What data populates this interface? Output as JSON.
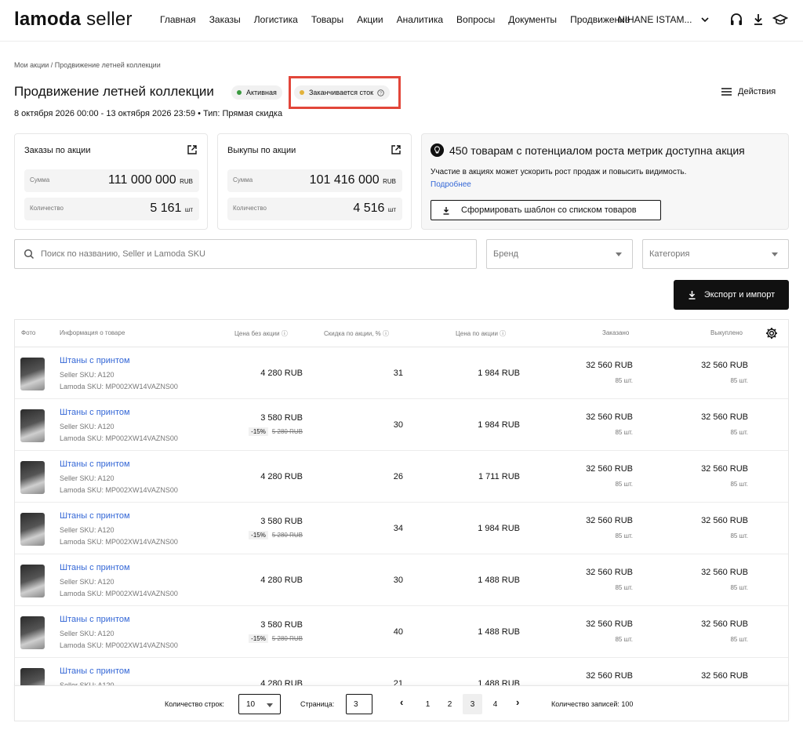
{
  "header": {
    "logo_brand": "lamoda",
    "logo_suffix": "seller",
    "nav": [
      "Главная",
      "Заказы",
      "Логистика",
      "Товары",
      "Акции",
      "Аналитика",
      "Вопросы",
      "Документы",
      "Продвижение"
    ],
    "user": "NIHANE ISTAM...",
    "icons": [
      "headphones-icon",
      "download-icon",
      "graduation-cap-icon"
    ]
  },
  "breadcrumb": "Мои акции  /  Продвижение летней коллекции",
  "promo_page": {
    "title": "Продвижение летней коллекции",
    "badge_active": "Активная",
    "badge_stock": "Заканчивается сток",
    "dates": "8 октября 2026 00:00 - 13 октября 2026 23:59  •  Тип: Прямая скидка",
    "actions": "Действия",
    "colors": {
      "active_dot": "#3a9a3f",
      "stock_dot": "#e2b23a",
      "highlight": "#e2463a",
      "link": "#3467d6"
    }
  },
  "cards": {
    "orders": {
      "title": "Заказы по акции",
      "sum_label": "Сумма",
      "sum_value": "111 000 000",
      "sum_unit": "RUB",
      "qty_label": "Количество",
      "qty_value": "5 161",
      "qty_unit": "шт"
    },
    "buyouts": {
      "title": "Выкупы по акции",
      "sum_label": "Сумма",
      "sum_value": "101 416 000",
      "sum_unit": "RUB",
      "qty_label": "Количество",
      "qty_value": "4 516",
      "qty_unit": "шт"
    }
  },
  "promo": {
    "title": "450 товарам с потенциалом роста метрик доступна акция",
    "text": "Участие в акциях может ускорить рост продаж и повысить видимость.",
    "link": "Подробнее",
    "button": "Сформировать шаблон со списком товаров"
  },
  "filters": {
    "search_placeholder": "Поиск по названию, Seller и Lamoda SKU",
    "brand": "Бренд",
    "category": "Категория",
    "export": "Экспорт и импорт"
  },
  "table": {
    "headers": {
      "photo": "Фото",
      "info": "Информация о товаре",
      "price": "Цена без акции",
      "discount": "Скидка по акции, %",
      "promo_price": "Цена по акции",
      "ordered": "Заказано",
      "bought": "Выкуплено"
    },
    "rows": [
      {
        "name": "Штаны с принтом",
        "seller_sku": "Seller SKU: A120",
        "lamoda_sku": "Lamoda SKU: MP002XW14VAZNS00",
        "price": "4 280 RUB",
        "disc_pct": "",
        "old_price": "",
        "discount": "31",
        "promo_price": "1 984 RUB",
        "ordered": "32 560 RUB",
        "ordered_qty": "85 шт.",
        "bought": "32 560 RUB",
        "bought_qty": "85 шт."
      },
      {
        "name": "Штаны с принтом",
        "seller_sku": "Seller SKU: A120",
        "lamoda_sku": "Lamoda SKU: MP002XW14VAZNS00",
        "price": "3 580 RUB",
        "disc_pct": "-15%",
        "old_price": "5 280 RUB",
        "discount": "30",
        "promo_price": "1 984 RUB",
        "ordered": "32 560 RUB",
        "ordered_qty": "85 шт.",
        "bought": "32 560 RUB",
        "bought_qty": "85 шт."
      },
      {
        "name": "Штаны с принтом",
        "seller_sku": "Seller SKU: A120",
        "lamoda_sku": "Lamoda SKU: MP002XW14VAZNS00",
        "price": "4 280 RUB",
        "disc_pct": "",
        "old_price": "",
        "discount": "26",
        "promo_price": "1 711 RUB",
        "ordered": "32 560 RUB",
        "ordered_qty": "85 шт.",
        "bought": "32 560 RUB",
        "bought_qty": "85 шт."
      },
      {
        "name": "Штаны с принтом",
        "seller_sku": "Seller SKU: A120",
        "lamoda_sku": "Lamoda SKU: MP002XW14VAZNS00",
        "price": "3 580 RUB",
        "disc_pct": "-15%",
        "old_price": "5 280 RUB",
        "discount": "34",
        "promo_price": "1 984 RUB",
        "ordered": "32 560 RUB",
        "ordered_qty": "85 шт.",
        "bought": "32 560 RUB",
        "bought_qty": "85 шт."
      },
      {
        "name": "Штаны с принтом",
        "seller_sku": "Seller SKU: A120",
        "lamoda_sku": "Lamoda SKU: MP002XW14VAZNS00",
        "price": "4 280 RUB",
        "disc_pct": "",
        "old_price": "",
        "discount": "30",
        "promo_price": "1 488 RUB",
        "ordered": "32 560 RUB",
        "ordered_qty": "85 шт.",
        "bought": "32 560 RUB",
        "bought_qty": "85 шт."
      },
      {
        "name": "Штаны с принтом",
        "seller_sku": "Seller SKU: A120",
        "lamoda_sku": "Lamoda SKU: MP002XW14VAZNS00",
        "price": "3 580 RUB",
        "disc_pct": "-15%",
        "old_price": "5 280 RUB",
        "discount": "40",
        "promo_price": "1 488 RUB",
        "ordered": "32 560 RUB",
        "ordered_qty": "85 шт.",
        "bought": "32 560 RUB",
        "bought_qty": "85 шт."
      },
      {
        "name": "Штаны с принтом",
        "seller_sku": "Seller SKU: A120",
        "lamoda_sku": "",
        "price": "4 280 RUB",
        "disc_pct": "",
        "old_price": "",
        "discount": "21",
        "promo_price": "1 488 RUB",
        "ordered": "32 560 RUB",
        "ordered_qty": "",
        "bought": "32 560 RUB",
        "bought_qty": ""
      }
    ]
  },
  "pager": {
    "rows_label": "Количество строк:",
    "rows_value": "10",
    "page_label": "Страница:",
    "page_value": "3",
    "pages": [
      "1",
      "2",
      "3",
      "4"
    ],
    "active_page": "3",
    "total": "Количество записей: 100"
  }
}
